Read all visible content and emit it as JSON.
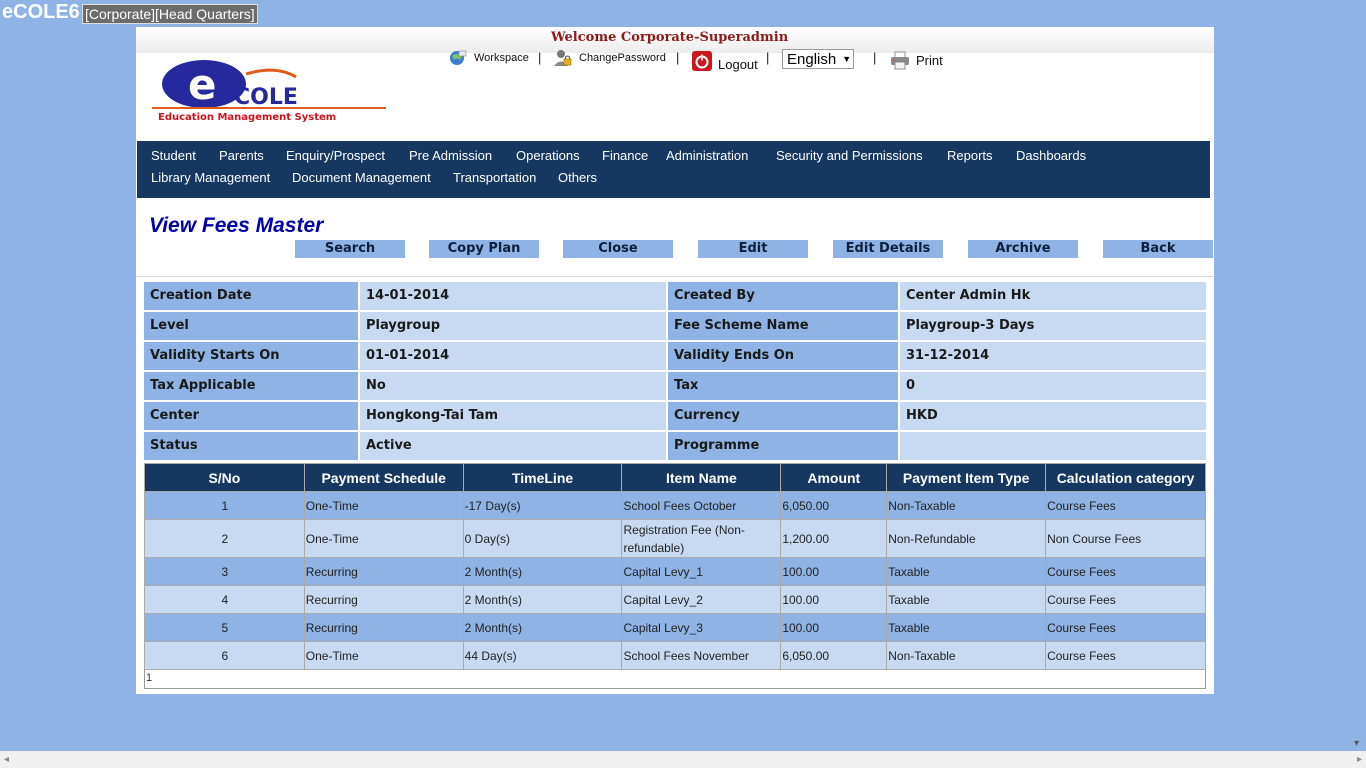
{
  "app": {
    "title": "eCOLE6",
    "context": "[Corporate][Head Quarters]"
  },
  "header": {
    "welcome": "Welcome Corporate-Superadmin",
    "links": {
      "workspace": "Workspace",
      "change_password": "ChangePassword",
      "logout": "Logout",
      "print": "Print"
    },
    "separator": "|",
    "language": "English",
    "logo": {
      "letter": "e",
      "name": "COLE",
      "tagline": "Education Management System"
    }
  },
  "nav": {
    "row1": [
      "Student",
      "Parents",
      "Enquiry/Prospect",
      "Pre Admission",
      "Operations",
      "Finance",
      "Administration",
      "Security and Permissions",
      "Reports",
      "Dashboards"
    ],
    "row2": [
      "Library Management",
      "Document Management",
      "Transportation",
      "Others"
    ]
  },
  "page": {
    "title": "View Fees Master"
  },
  "buttons": {
    "search": "Search",
    "copy_plan": "Copy Plan",
    "close": "Close",
    "edit": "Edit",
    "edit_details": "Edit Details",
    "archive": "Archive",
    "back": "Back"
  },
  "details": {
    "creation_date": {
      "label": "Creation Date",
      "value": "14-01-2014"
    },
    "created_by": {
      "label": "Created By",
      "value": "Center Admin Hk"
    },
    "level": {
      "label": "Level",
      "value": "Playgroup"
    },
    "fee_scheme_name": {
      "label": "Fee Scheme Name",
      "value": "Playgroup-3 Days"
    },
    "validity_starts_on": {
      "label": "Validity Starts On",
      "value": "01-01-2014"
    },
    "validity_ends_on": {
      "label": "Validity Ends On",
      "value": "31-12-2014"
    },
    "tax_applicable": {
      "label": "Tax Applicable",
      "value": "No"
    },
    "tax": {
      "label": "Tax",
      "value": "0"
    },
    "center": {
      "label": "Center",
      "value": "Hongkong-Tai Tam"
    },
    "currency": {
      "label": "Currency",
      "value": "HKD"
    },
    "status": {
      "label": "Status",
      "value": "Active"
    },
    "programme": {
      "label": "Programme",
      "value": ""
    }
  },
  "grid": {
    "columns": [
      "S/No",
      "Payment Schedule",
      "TimeLine",
      "Item Name",
      "Amount",
      "Payment Item Type",
      "Calculation category"
    ],
    "rows": [
      [
        "1",
        "One-Time",
        "-17 Day(s)",
        "School Fees October",
        "6,050.00",
        "Non-Taxable",
        "Course Fees"
      ],
      [
        "2",
        "One-Time",
        "0 Day(s)",
        "Registration Fee (Non-refundable)",
        "1,200.00",
        "Non-Refundable",
        "Non Course Fees"
      ],
      [
        "3",
        "Recurring",
        "2 Month(s)",
        "Capital Levy_1",
        "100.00",
        "Taxable",
        "Course Fees"
      ],
      [
        "4",
        "Recurring",
        "2 Month(s)",
        "Capital Levy_2",
        "100.00",
        "Taxable",
        "Course Fees"
      ],
      [
        "5",
        "Recurring",
        "2 Month(s)",
        "Capital Levy_3",
        "100.00",
        "Taxable",
        "Course Fees"
      ],
      [
        "6",
        "One-Time",
        "44 Day(s)",
        "School Fees November",
        "6,050.00",
        "Non-Taxable",
        "Course Fees"
      ]
    ],
    "pager": "1"
  },
  "colors": {
    "background": "#8eb3e4",
    "nav": "#163760",
    "title": "#0000a8",
    "welcome": "#8b1b1b",
    "label_cell": "#8eb3e4",
    "value_cell": "#c7daf2"
  },
  "scrollbar": {
    "left_arrow": "◂",
    "right_arrow": "▸",
    "down_arrow": "▾"
  }
}
